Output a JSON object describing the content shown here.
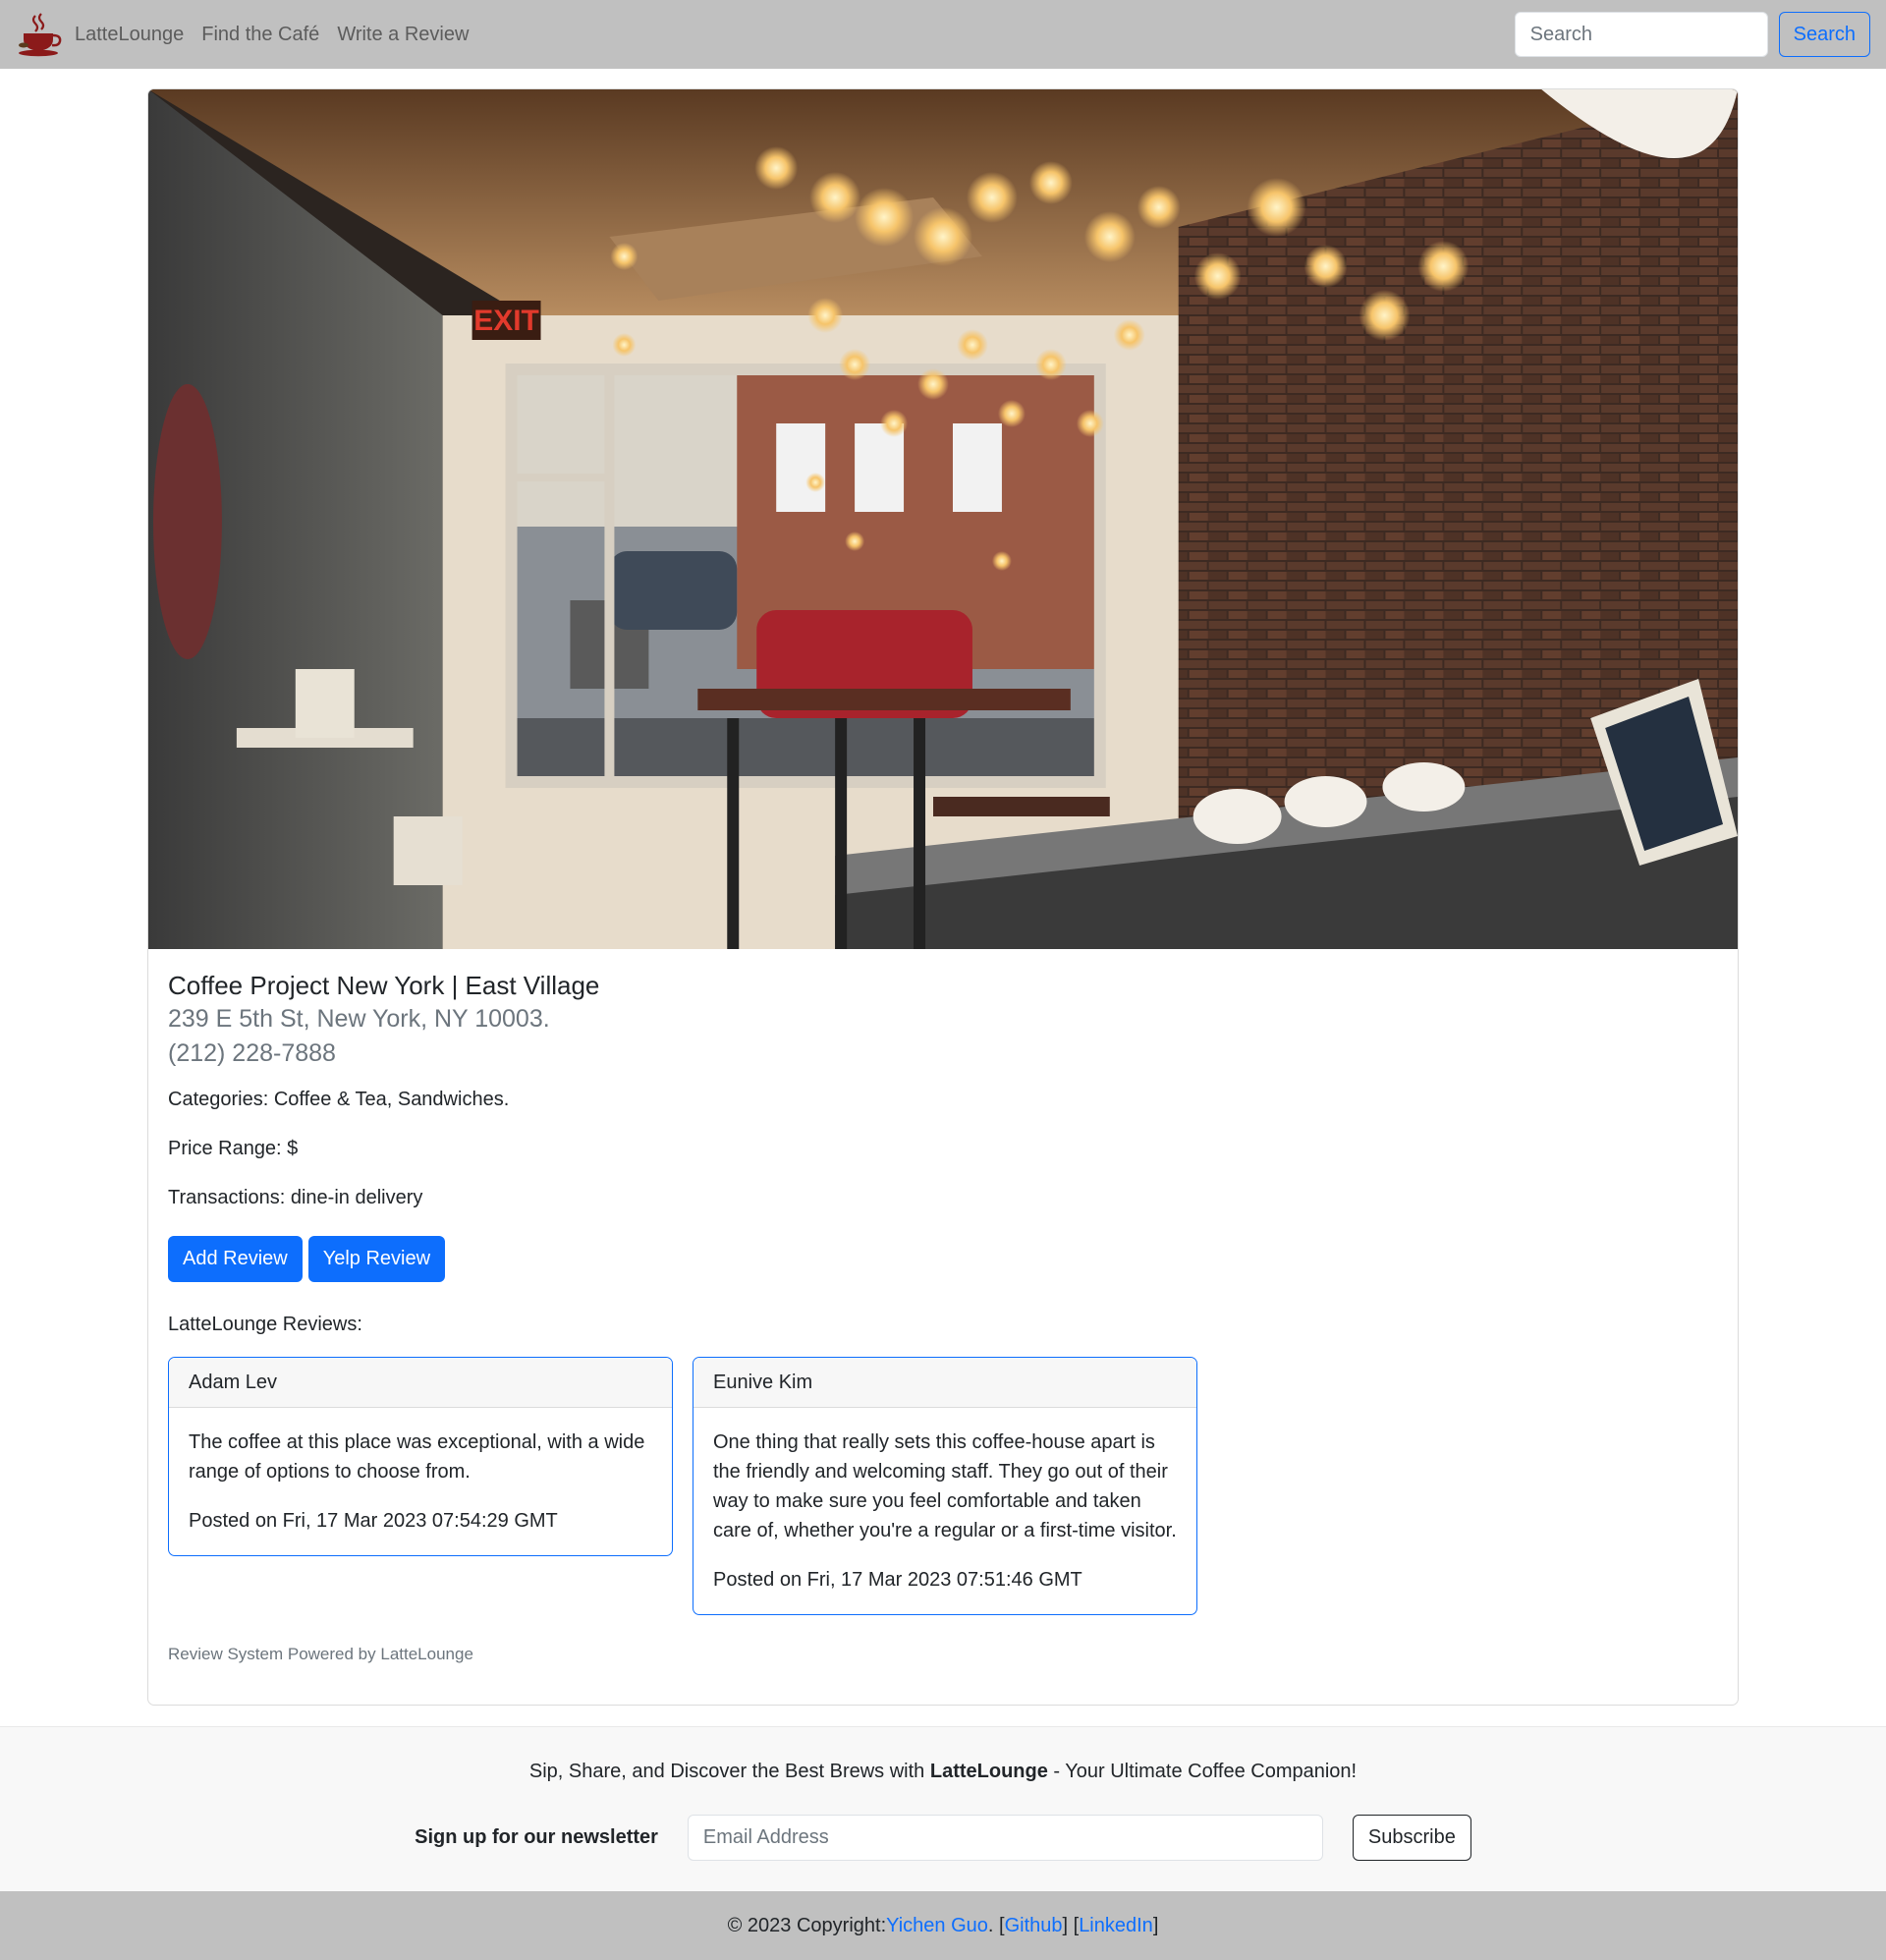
{
  "nav": {
    "brand": "LatteLounge",
    "links": [
      "Find the Café",
      "Write a Review"
    ],
    "search_placeholder": "Search",
    "search_button": "Search"
  },
  "cafe": {
    "name": "Coffee Project New York | East Village",
    "address": "239 E 5th St, New York, NY 10003.",
    "phone": "(212) 228-7888",
    "categories": "Categories: Coffee & Tea, Sandwiches.",
    "price_range": "Price Range: $",
    "transactions": "Transactions: dine-in delivery",
    "add_review_button": "Add Review",
    "yelp_review_button": "Yelp Review",
    "reviews_label": "LatteLounge Reviews:",
    "reviews": [
      {
        "author": "Adam Lev",
        "text": "The coffee at this place was exceptional, with a wide range of options to choose from.",
        "posted": "Posted on Fri, 17 Mar 2023 07:54:29 GMT"
      },
      {
        "author": "Eunive Kim",
        "text": "One thing that really sets this coffee-house apart is the friendly and welcoming staff. They go out of their way to make sure you feel comfortable and taken care of, whether you're a regular or a first-time visitor.",
        "posted": "Posted on Fri, 17 Mar 2023 07:51:46 GMT"
      }
    ],
    "powered_by": "Review System Powered by LatteLounge"
  },
  "footer": {
    "tagline_pre": "Sip, Share, and Discover the Best Brews with ",
    "tagline_brand": "LatteLounge",
    "tagline_post": " - Your Ultimate Coffee Companion!",
    "newsletter_label": "Sign up for our newsletter",
    "email_placeholder": "Email Address",
    "subscribe_button": "Subscribe",
    "copyright_pre": "© 2023 Copyright: ",
    "author_link": "Yichen Guo",
    "sep1": ". [",
    "github_link": "Github",
    "sep2": "] [",
    "linkedin_link": "LinkedIn",
    "sep3": "]"
  },
  "colors": {
    "navbar": "#c0c0c0",
    "primary": "#0d6efd",
    "muted": "#6c757d"
  }
}
